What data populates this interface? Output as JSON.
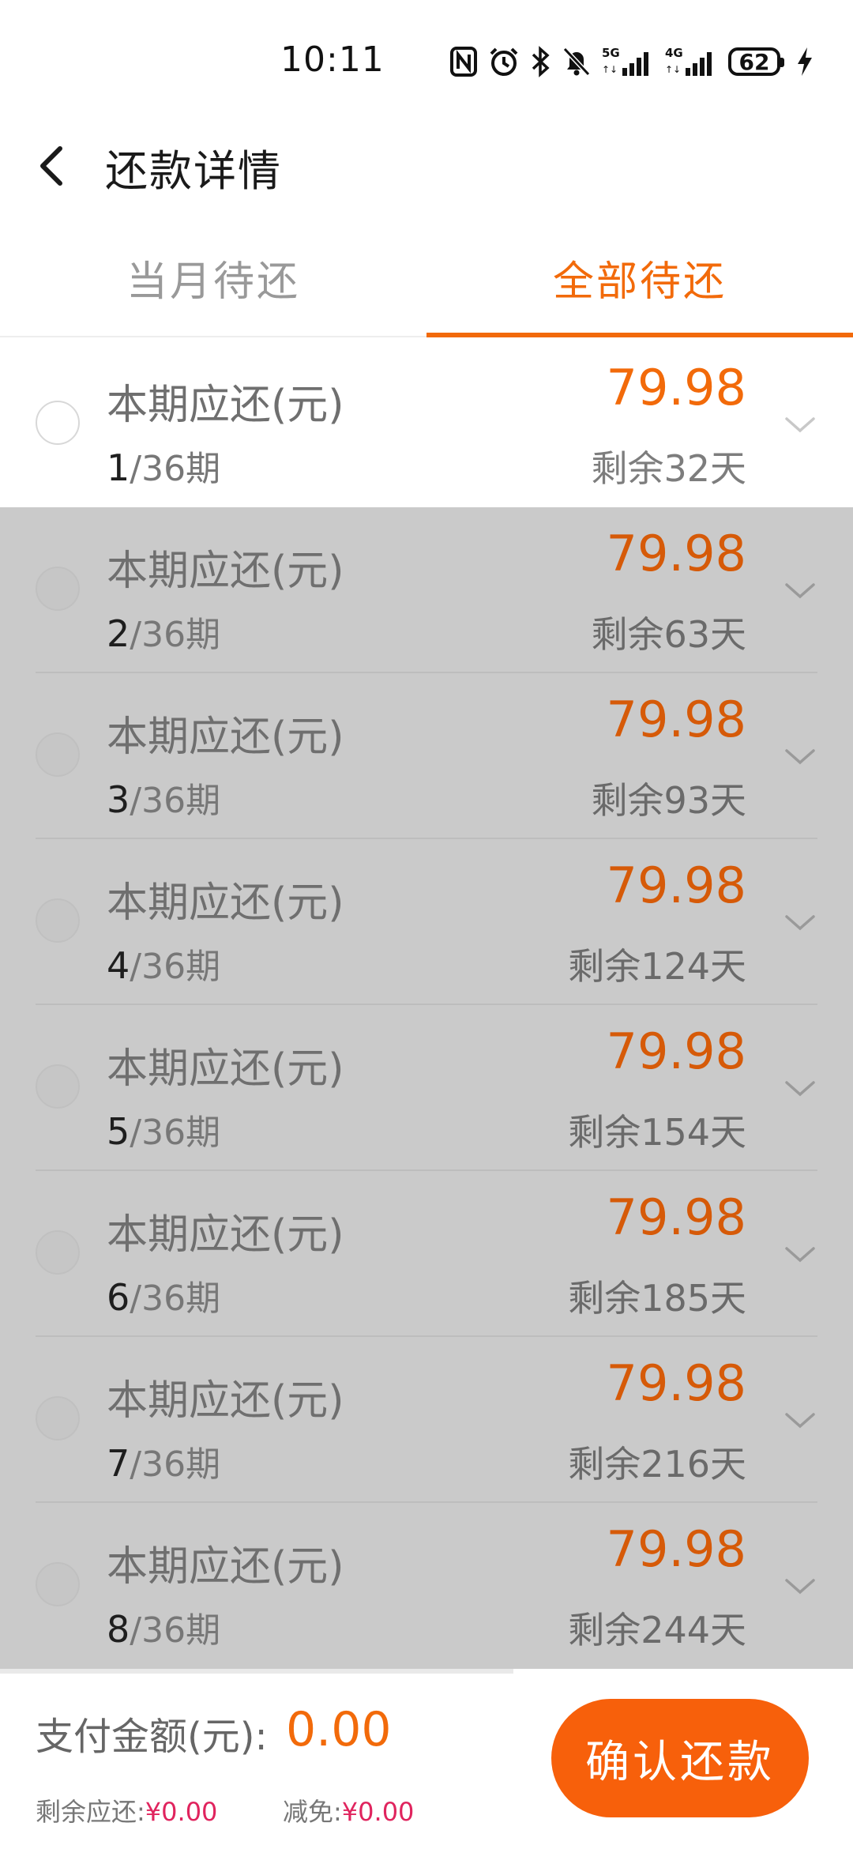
{
  "status_bar": {
    "time": "10:11",
    "battery": "62",
    "icons": [
      "nfc-icon",
      "alarm-icon",
      "bluetooth-icon",
      "mute-bell-icon",
      "signal-5g-icon",
      "signal-4g-icon",
      "battery-icon",
      "charging-icon"
    ]
  },
  "header": {
    "title": "还款详情",
    "back_icon": "chevron-left-icon"
  },
  "tabs": [
    {
      "label": "当月待还",
      "active": false
    },
    {
      "label": "全部待还",
      "active": true
    }
  ],
  "colors": {
    "accent": "#f26a0a",
    "button": "#f7600b",
    "highlight_value": "#e0245e",
    "overlay_gray": "#cacaca"
  },
  "installments": [
    {
      "label": "本期应还(元)",
      "current": "1",
      "total": "/36期",
      "amount": "79.98",
      "remaining": "剩余32天"
    },
    {
      "label": "本期应还(元)",
      "current": "2",
      "total": "/36期",
      "amount": "79.98",
      "remaining": "剩余63天"
    },
    {
      "label": "本期应还(元)",
      "current": "3",
      "total": "/36期",
      "amount": "79.98",
      "remaining": "剩余93天"
    },
    {
      "label": "本期应还(元)",
      "current": "4",
      "total": "/36期",
      "amount": "79.98",
      "remaining": "剩余124天"
    },
    {
      "label": "本期应还(元)",
      "current": "5",
      "total": "/36期",
      "amount": "79.98",
      "remaining": "剩余154天"
    },
    {
      "label": "本期应还(元)",
      "current": "6",
      "total": "/36期",
      "amount": "79.98",
      "remaining": "剩余185天"
    },
    {
      "label": "本期应还(元)",
      "current": "7",
      "total": "/36期",
      "amount": "79.98",
      "remaining": "剩余216天"
    },
    {
      "label": "本期应还(元)",
      "current": "8",
      "total": "/36期",
      "amount": "79.98",
      "remaining": "剩余244天"
    }
  ],
  "footer": {
    "pay_label": "支付金额(元):",
    "pay_amount": "0.00",
    "remaining_label": "剩余应还:",
    "remaining_value": "¥0.00",
    "waive_label": "减免:",
    "waive_value": "¥0.00",
    "confirm_label": "确认还款"
  }
}
